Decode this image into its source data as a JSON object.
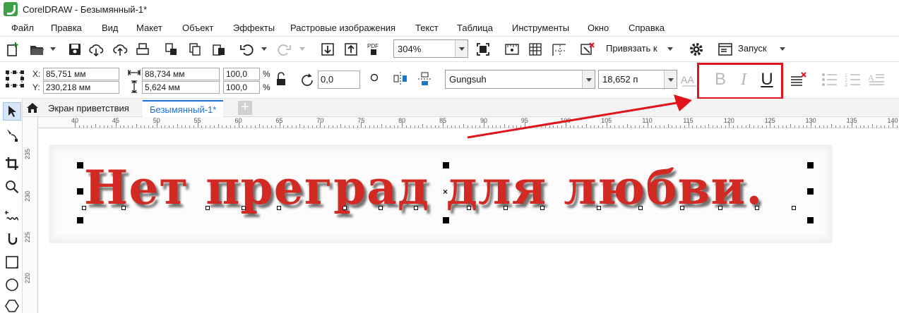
{
  "window": {
    "title": "CorelDRAW - Безымянный-1*"
  },
  "menu": [
    "Файл",
    "Правка",
    "Вид",
    "Макет",
    "Объект",
    "Эффекты",
    "Растровые изображения",
    "Текст",
    "Таблица",
    "Инструменты",
    "Окно",
    "Справка"
  ],
  "toolbar": {
    "zoom": "304%",
    "snap_label": "Привязать к",
    "launch_label": "Запуск",
    "icons": [
      "new-document-icon",
      "open-folder-icon",
      "save-icon",
      "cloud-download-icon",
      "cloud-upload-icon",
      "print-icon",
      "cut-icon",
      "copy-icon",
      "paste-icon",
      "undo-icon",
      "redo-icon",
      "import-icon",
      "export-icon",
      "pdf-export-icon",
      "fullscreen-icon",
      "rulers-icon",
      "grid-icon",
      "guidelines-icon",
      "snap-off-icon",
      "settings-gear-icon",
      "application-launcher-icon"
    ]
  },
  "property_bar": {
    "x_label": "X:",
    "y_label": "Y:",
    "x_value": "85,751 мм",
    "y_value": "230,218 мм",
    "width_value": "88,734 мм",
    "height_value": "5,624 мм",
    "scale_x": "100,0",
    "scale_y": "100,0",
    "percent": "%",
    "rotation": "0,0",
    "font_name": "Gungsuh",
    "font_size": "18,652 п",
    "bold_glyph": "B",
    "italic_glyph": "I",
    "underline_glyph": "U"
  },
  "tabs": {
    "welcome": "Экран приветствия",
    "document": "Безымянный-1*",
    "add_glyph": "+"
  },
  "ruler": {
    "top_labels": [
      "40",
      "45",
      "50",
      "55",
      "60",
      "65",
      "70",
      "75",
      "80",
      "85",
      "90",
      "95",
      "100",
      "105",
      "110",
      "115",
      "120",
      "125",
      "130",
      "135",
      "140"
    ],
    "left_labels": [
      "235",
      "230",
      "225",
      "220"
    ]
  },
  "canvas": {
    "text": "Нет преград для любви.",
    "text_color": "#d22a23",
    "center_mark": "×"
  },
  "annotation": {
    "highlight_color": "#e2141b"
  }
}
